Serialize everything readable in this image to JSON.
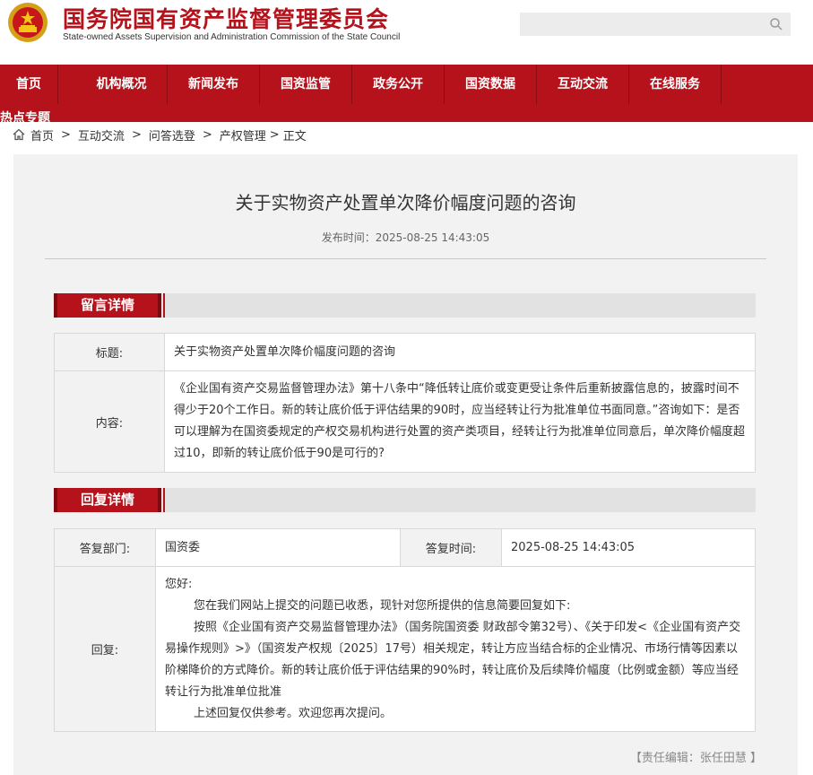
{
  "header": {
    "site_title": "国务院国有资产监督管理委员会",
    "site_subtitle": "State-owned Assets Supervision and Administration Commission of the State Council",
    "search_placeholder": "",
    "brand_color": "#b5121b"
  },
  "nav": {
    "items": [
      {
        "label": "首页"
      },
      {
        "label": "机构概况"
      },
      {
        "label": "新闻发布"
      },
      {
        "label": "国资监管"
      },
      {
        "label": "政务公开"
      },
      {
        "label": "国资数据"
      },
      {
        "label": "互动交流"
      },
      {
        "label": "在线服务"
      }
    ],
    "hot": "热点专题"
  },
  "breadcrumb": {
    "items": [
      "首页",
      "互动交流",
      "问答选登",
      "产权管理",
      "正文"
    ],
    "separator": ">"
  },
  "article": {
    "title": "关于实物资产处置单次降价幅度问题的咨询",
    "meta": "发布时间：2025-08-25 14:43:05"
  },
  "message": {
    "section_label": "留言详情",
    "title_label": "标题:",
    "title_value": "关于实物资产处置单次降价幅度问题的咨询",
    "content_label": "内容:",
    "content_value": "《企业国有资产交易监督管理办法》第十八条中“降低转让底价或变更受让条件后重新披露信息的，披露时间不得少于20个工作日。新的转让底价低于评估结果的90时，应当经转让行为批准单位书面同意。”咨询如下：是否可以理解为在国资委规定的产权交易机构进行处置的资产类项目，经转让行为批准单位同意后，单次降价幅度超过10，即新的转让底价低于90是可行的?"
  },
  "reply": {
    "section_label": "回复详情",
    "dept_label": "答复部门:",
    "dept_value": "国资委",
    "time_label": "答复时间:",
    "time_value": "2025-08-25 14:43:05",
    "reply_label": "回复:",
    "greeting": "您好:",
    "p1": "您在我们网站上提交的问题已收悉，现针对您所提供的信息简要回复如下:",
    "p2": "按照《企业国有资产交易监督管理办法》（国务院国资委 财政部令第32号）、《关于印发<《企业国有资产交易操作规则》>》（国资发产权规〔2025〕17号）相关规定，转让方应当结合标的企业情况、市场行情等因素以阶梯降价的方式降价。新的转让底价低于评估结果的90%时，转让底价及后续降价幅度（比例或金额）等应当经转让行为批准单位批准",
    "p3": "上述回复仅供参考。欢迎您再次提问。"
  },
  "editor": "【责任编辑：张任田慧 】"
}
